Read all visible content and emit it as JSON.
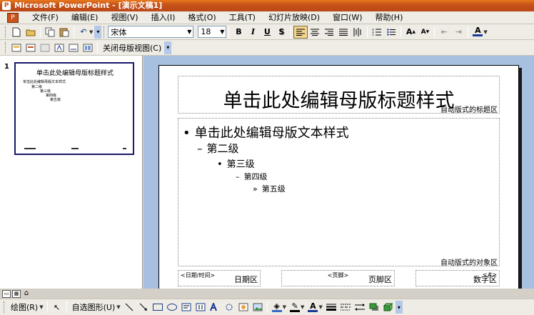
{
  "window": {
    "title": "Microsoft PowerPoint - [演示文稿1]"
  },
  "menubar": {
    "items": [
      "文件(F)",
      "编辑(E)",
      "视图(V)",
      "插入(I)",
      "格式(O)",
      "工具(T)",
      "幻灯片放映(D)",
      "窗口(W)",
      "帮助(H)"
    ]
  },
  "formatting": {
    "font_name": "宋体",
    "font_size": "18"
  },
  "master_toolbar": {
    "close_label": "关闭母版视图(C)"
  },
  "thumbnails": [
    {
      "number": "1",
      "title": "单击此处编辑母版标题样式",
      "lines": [
        "单击此处编辑母版文本样式",
        "第二级",
        "第三级",
        "第四级",
        "第五级"
      ]
    }
  ],
  "slide": {
    "title": "单击此处编辑母版标题样式",
    "title_area_label": "自动版式的标题区",
    "body_levels": [
      {
        "bullet": "•",
        "text": "单击此处编辑母版文本样式"
      },
      {
        "bullet": "–",
        "text": "第二级"
      },
      {
        "bullet": "•",
        "text": "第三级"
      },
      {
        "bullet": "–",
        "text": "第四级"
      },
      {
        "bullet": "»",
        "text": "第五级"
      }
    ],
    "object_area_label": "自动版式的对象区",
    "date_placeholder": "<日期/时间>",
    "date_area_label": "日期区",
    "footer_placeholder": "<页脚>",
    "footer_area_label": "页脚区",
    "number_placeholder": "<#>",
    "number_area_label": "数字区"
  },
  "drawing": {
    "draw_label": "绘图(R)",
    "autoshapes_label": "自选图形(U)"
  },
  "colors": {
    "title_bar": "#c8531a",
    "canvas_bg": "#a8c0e0",
    "toolbar_bg": "#eeece5"
  }
}
